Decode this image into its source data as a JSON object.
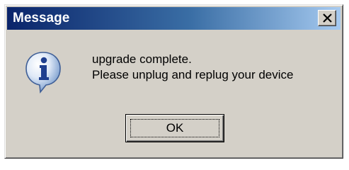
{
  "window": {
    "title": "Message",
    "close_icon": "close-icon"
  },
  "message": {
    "icon": "information-icon",
    "lines": [
      "upgrade complete.",
      "Please unplug and replug your device"
    ]
  },
  "buttons": {
    "ok_label": "OK"
  },
  "colors": {
    "title_bar_start": "#0a246a",
    "title_bar_end": "#a6caf0",
    "dialog_face": "#d4d0c8"
  }
}
